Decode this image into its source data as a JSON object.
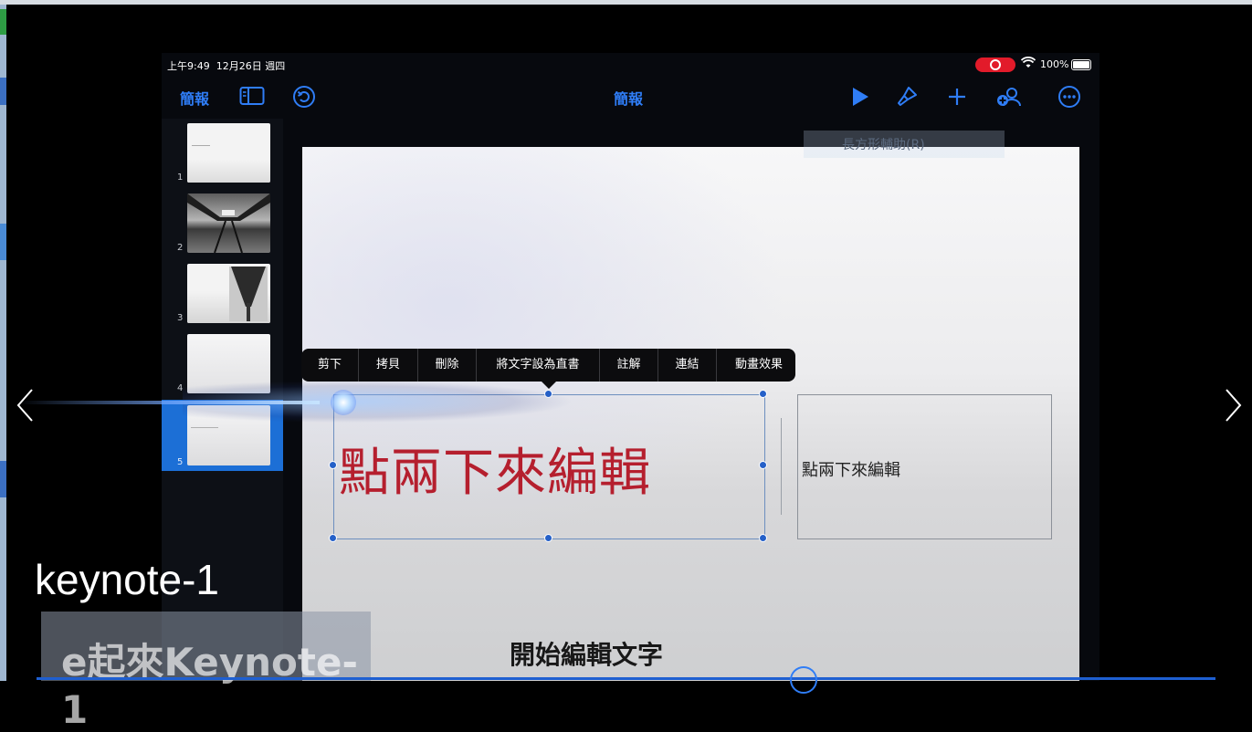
{
  "status_bar": {
    "time": "上午9:49",
    "date": "12月26日 週四",
    "battery": "100%"
  },
  "toolbar": {
    "back_label": "簡報",
    "document_title": "簡報",
    "accent_color": "#2f7df6"
  },
  "slides": [
    {
      "number": "1"
    },
    {
      "number": "2"
    },
    {
      "number": "3"
    },
    {
      "number": "4"
    },
    {
      "number": "5",
      "selected": true
    }
  ],
  "background_menu_item": "長方形輔助(R)",
  "context_menu": [
    {
      "label": "剪下",
      "width": 62
    },
    {
      "label": "拷貝",
      "width": 64
    },
    {
      "label": "刪除",
      "width": 63
    },
    {
      "label": "將文字設為直書",
      "width": 134
    },
    {
      "label": "註解",
      "width": 63
    },
    {
      "label": "連結",
      "width": 63
    },
    {
      "label": "動畫效果",
      "width": 92
    }
  ],
  "slide": {
    "title_placeholder": "點兩下來編輯",
    "title_color": "#b51f2e",
    "side_placeholder": "點兩下來編輯",
    "subtitle": "開始編輯文字"
  },
  "video_overlay": {
    "label": "keynote-1",
    "caption": "e起來Keynote-1"
  }
}
